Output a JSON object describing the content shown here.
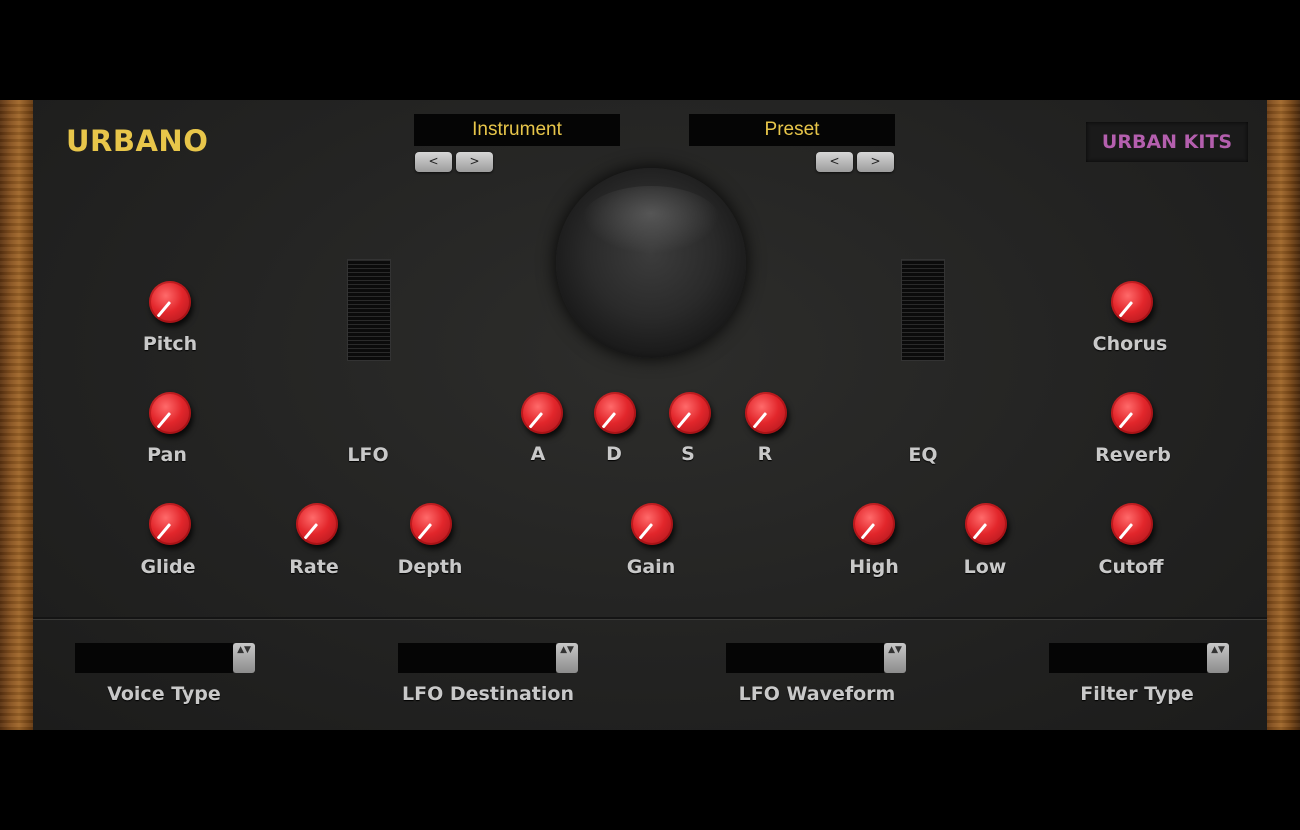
{
  "brand": "URBANO",
  "brand_right": "URBAN KITS",
  "instrument": {
    "label": "Instrument",
    "prev": "<",
    "next": ">"
  },
  "preset": {
    "label": "Preset",
    "prev": "<",
    "next": ">"
  },
  "knobs": {
    "pitch": "Pitch",
    "pan": "Pan",
    "glide": "Glide",
    "rate": "Rate",
    "depth": "Depth",
    "attack": "A",
    "decay": "D",
    "sustain": "S",
    "release": "R",
    "gain": "Gain",
    "high": "High",
    "low": "Low",
    "chorus": "Chorus",
    "reverb": "Reverb",
    "cutoff": "Cutoff"
  },
  "sections": {
    "lfo": "LFO",
    "eq": "EQ"
  },
  "selects": {
    "voice_type": "Voice Type",
    "lfo_destination": "LFO Destination",
    "lfo_waveform": "LFO Waveform",
    "filter_type": "Filter Type",
    "spinner_glyph": "▲▼"
  },
  "colors": {
    "brand": "#e8c64a",
    "brand_right": "#b45fae",
    "knob": "#e2262b",
    "label": "#c9c9c9"
  }
}
